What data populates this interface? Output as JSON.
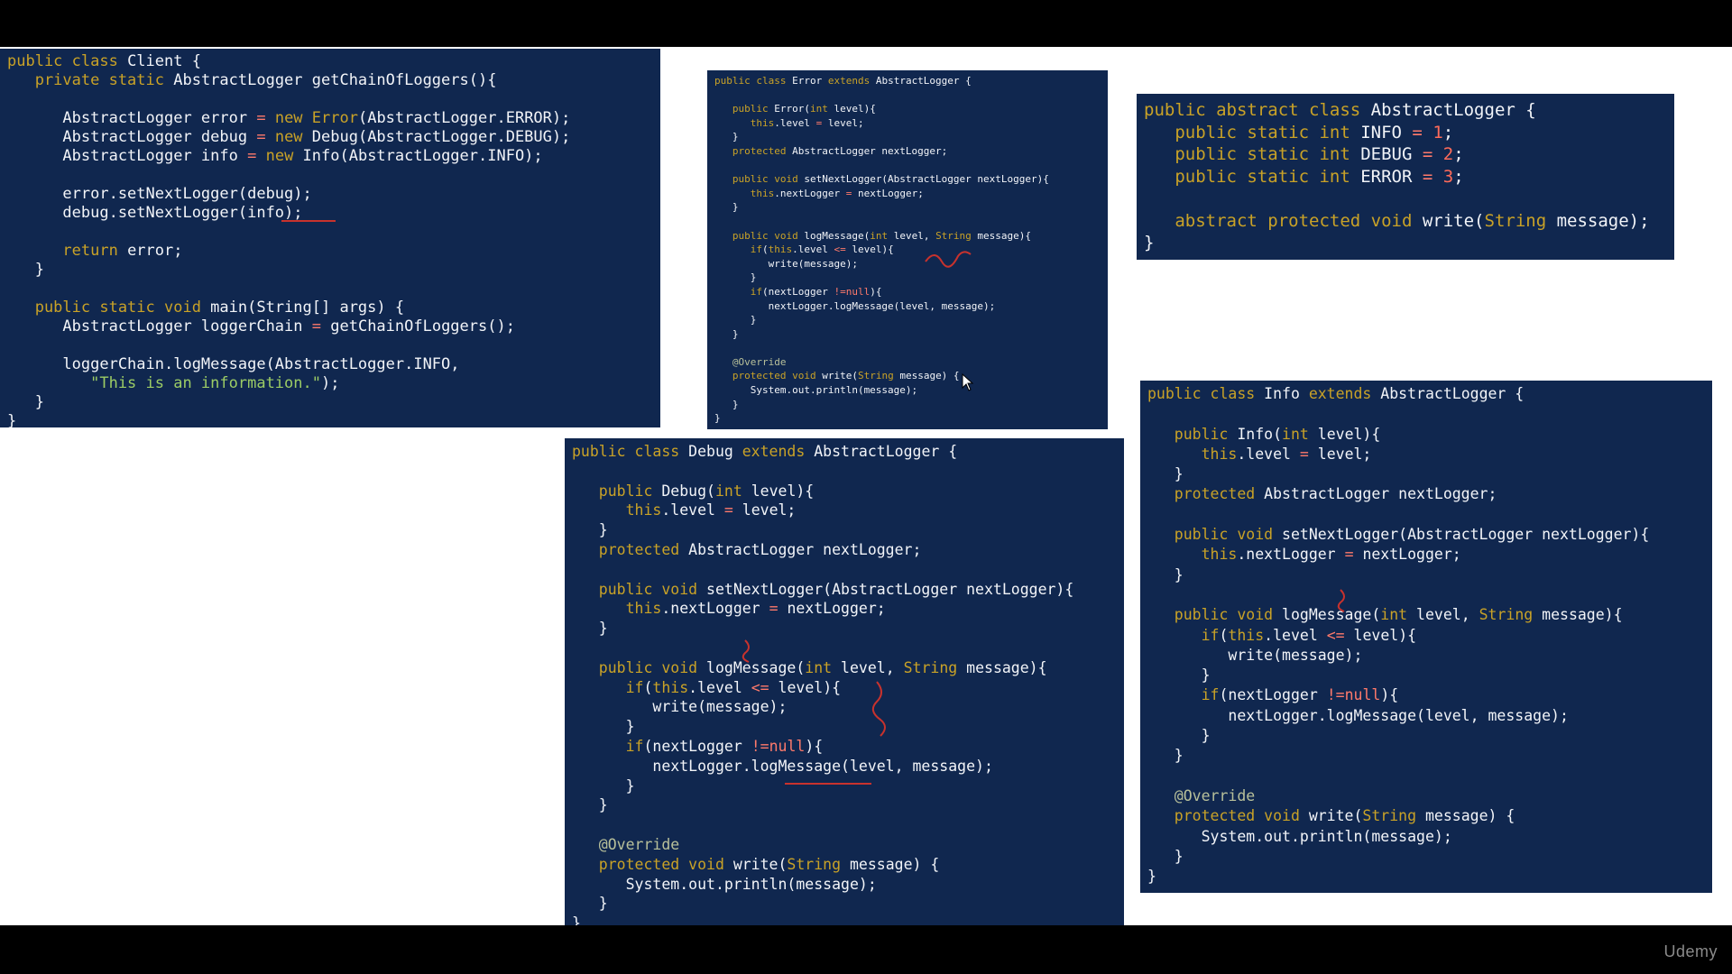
{
  "panels": [
    {
      "id": "client",
      "lines": [
        [
          [
            "kw",
            "public class "
          ],
          [
            "id",
            "Client {"
          ]
        ],
        [
          [
            "kw",
            "   private static "
          ],
          [
            "id",
            "AbstractLogger getChainOfLoggers(){"
          ]
        ],
        [
          [
            "id",
            ""
          ]
        ],
        [
          [
            "id",
            "      AbstractLogger error "
          ],
          [
            "op",
            "= "
          ],
          [
            "kw",
            "new "
          ],
          [
            "kw",
            "Error"
          ],
          [
            "id",
            "(AbstractLogger.ERROR);"
          ]
        ],
        [
          [
            "id",
            "      AbstractLogger debug "
          ],
          [
            "op",
            "= "
          ],
          [
            "kw",
            "new "
          ],
          [
            "id",
            "Debug(AbstractLogger.DEBUG);"
          ]
        ],
        [
          [
            "id",
            "      AbstractLogger info "
          ],
          [
            "op",
            "= "
          ],
          [
            "kw",
            "new "
          ],
          [
            "id",
            "Info(AbstractLogger.INFO);"
          ]
        ],
        [
          [
            "id",
            ""
          ]
        ],
        [
          [
            "id",
            "      error.setNextLogger(debug);"
          ]
        ],
        [
          [
            "id",
            "      debug.setNextLogger(info);"
          ]
        ],
        [
          [
            "id",
            ""
          ]
        ],
        [
          [
            "kw",
            "      return "
          ],
          [
            "id",
            "error;"
          ]
        ],
        [
          [
            "id",
            "   }"
          ]
        ],
        [
          [
            "id",
            ""
          ]
        ],
        [
          [
            "kw",
            "   public static void "
          ],
          [
            "id",
            "main(String[] args) {"
          ]
        ],
        [
          [
            "id",
            "      AbstractLogger loggerChain "
          ],
          [
            "op",
            "= "
          ],
          [
            "id",
            "getChainOfLoggers();"
          ]
        ],
        [
          [
            "id",
            ""
          ]
        ],
        [
          [
            "id",
            "      loggerChain.logMessage(AbstractLogger.INFO,"
          ]
        ],
        [
          [
            "str",
            "         \"This is an information.\""
          ],
          [
            "id",
            ");"
          ]
        ],
        [
          [
            "id",
            "   }"
          ]
        ],
        [
          [
            "id",
            "}"
          ]
        ]
      ]
    },
    {
      "id": "error",
      "lines": [
        [
          [
            "kw",
            "public class "
          ],
          [
            "id",
            "Error "
          ],
          [
            "kw",
            "extends "
          ],
          [
            "id",
            "AbstractLogger {"
          ]
        ],
        [
          [
            "id",
            ""
          ]
        ],
        [
          [
            "kw",
            "   public "
          ],
          [
            "id",
            "Error("
          ],
          [
            "kw",
            "int "
          ],
          [
            "id",
            "level){"
          ]
        ],
        [
          [
            "kw",
            "      this"
          ],
          [
            "id",
            ".level "
          ],
          [
            "op",
            "= "
          ],
          [
            "id",
            "level;"
          ]
        ],
        [
          [
            "id",
            "   }"
          ]
        ],
        [
          [
            "kw",
            "   protected "
          ],
          [
            "id",
            "AbstractLogger nextLogger;"
          ]
        ],
        [
          [
            "id",
            ""
          ]
        ],
        [
          [
            "kw",
            "   public void "
          ],
          [
            "id",
            "setNextLogger(AbstractLogger nextLogger){"
          ]
        ],
        [
          [
            "kw",
            "      this"
          ],
          [
            "id",
            ".nextLogger "
          ],
          [
            "op",
            "= "
          ],
          [
            "id",
            "nextLogger;"
          ]
        ],
        [
          [
            "id",
            "   }"
          ]
        ],
        [
          [
            "id",
            ""
          ]
        ],
        [
          [
            "kw",
            "   public void "
          ],
          [
            "id",
            "logMessage("
          ],
          [
            "kw",
            "int "
          ],
          [
            "id",
            "level, "
          ],
          [
            "kw",
            "String "
          ],
          [
            "id",
            "message){"
          ]
        ],
        [
          [
            "kw",
            "      if"
          ],
          [
            "id",
            "("
          ],
          [
            "kw",
            "this"
          ],
          [
            "id",
            ".level "
          ],
          [
            "op",
            "<= "
          ],
          [
            "id",
            "level){"
          ]
        ],
        [
          [
            "id",
            "         write(message);"
          ]
        ],
        [
          [
            "id",
            "      }"
          ]
        ],
        [
          [
            "kw",
            "      if"
          ],
          [
            "id",
            "(nextLogger "
          ],
          [
            "op",
            "!=null"
          ],
          [
            "id",
            "){"
          ]
        ],
        [
          [
            "id",
            "         nextLogger.logMessage(level, message);"
          ]
        ],
        [
          [
            "id",
            "      }"
          ]
        ],
        [
          [
            "id",
            "   }"
          ]
        ],
        [
          [
            "id",
            ""
          ]
        ],
        [
          [
            "ann",
            "   @Override"
          ]
        ],
        [
          [
            "kw",
            "   protected void "
          ],
          [
            "id",
            "write("
          ],
          [
            "kw",
            "String "
          ],
          [
            "id",
            "message) {"
          ]
        ],
        [
          [
            "id",
            "      System.out.println(message);"
          ]
        ],
        [
          [
            "id",
            "   }"
          ]
        ],
        [
          [
            "id",
            "}"
          ]
        ]
      ]
    },
    {
      "id": "abstract",
      "lines": [
        [
          [
            "kw",
            "public abstract class "
          ],
          [
            "id",
            "AbstractLogger {"
          ]
        ],
        [
          [
            "kw",
            "   public static int "
          ],
          [
            "id",
            "INFO "
          ],
          [
            "op",
            "= "
          ],
          [
            "num",
            "1"
          ],
          [
            "id",
            ";"
          ]
        ],
        [
          [
            "kw",
            "   public static int "
          ],
          [
            "id",
            "DEBUG "
          ],
          [
            "op",
            "= "
          ],
          [
            "num",
            "2"
          ],
          [
            "id",
            ";"
          ]
        ],
        [
          [
            "kw",
            "   public static int "
          ],
          [
            "id",
            "ERROR "
          ],
          [
            "op",
            "= "
          ],
          [
            "num",
            "3"
          ],
          [
            "id",
            ";"
          ]
        ],
        [
          [
            "id",
            ""
          ]
        ],
        [
          [
            "kw",
            "   abstract protected void "
          ],
          [
            "id",
            "write("
          ],
          [
            "kw",
            "String "
          ],
          [
            "id",
            "message);"
          ]
        ],
        [
          [
            "id",
            "}"
          ]
        ]
      ]
    },
    {
      "id": "debug",
      "lines": [
        [
          [
            "kw",
            "public class "
          ],
          [
            "id",
            "Debug "
          ],
          [
            "kw",
            "extends "
          ],
          [
            "id",
            "AbstractLogger {"
          ]
        ],
        [
          [
            "id",
            ""
          ]
        ],
        [
          [
            "kw",
            "   public "
          ],
          [
            "id",
            "Debug("
          ],
          [
            "kw",
            "int "
          ],
          [
            "id",
            "level){"
          ]
        ],
        [
          [
            "kw",
            "      this"
          ],
          [
            "id",
            ".level "
          ],
          [
            "op",
            "= "
          ],
          [
            "id",
            "level;"
          ]
        ],
        [
          [
            "id",
            "   }"
          ]
        ],
        [
          [
            "kw",
            "   protected "
          ],
          [
            "id",
            "AbstractLogger nextLogger;"
          ]
        ],
        [
          [
            "id",
            ""
          ]
        ],
        [
          [
            "kw",
            "   public void "
          ],
          [
            "id",
            "setNextLogger(AbstractLogger nextLogger){"
          ]
        ],
        [
          [
            "kw",
            "      this"
          ],
          [
            "id",
            ".nextLogger "
          ],
          [
            "op",
            "= "
          ],
          [
            "id",
            "nextLogger;"
          ]
        ],
        [
          [
            "id",
            "   }"
          ]
        ],
        [
          [
            "id",
            ""
          ]
        ],
        [
          [
            "kw",
            "   public void "
          ],
          [
            "id",
            "logMessage("
          ],
          [
            "kw",
            "int "
          ],
          [
            "id",
            "level, "
          ],
          [
            "kw",
            "String "
          ],
          [
            "id",
            "message){"
          ]
        ],
        [
          [
            "kw",
            "      if"
          ],
          [
            "id",
            "("
          ],
          [
            "kw",
            "this"
          ],
          [
            "id",
            ".level "
          ],
          [
            "op",
            "<= "
          ],
          [
            "id",
            "level){"
          ]
        ],
        [
          [
            "id",
            "         write(message);"
          ]
        ],
        [
          [
            "id",
            "      }"
          ]
        ],
        [
          [
            "kw",
            "      if"
          ],
          [
            "id",
            "(nextLogger "
          ],
          [
            "op",
            "!=null"
          ],
          [
            "id",
            "){"
          ]
        ],
        [
          [
            "id",
            "         nextLogger.logMessage(level, message);"
          ]
        ],
        [
          [
            "id",
            "      }"
          ]
        ],
        [
          [
            "id",
            "   }"
          ]
        ],
        [
          [
            "id",
            ""
          ]
        ],
        [
          [
            "ann",
            "   @Override"
          ]
        ],
        [
          [
            "kw",
            "   protected void "
          ],
          [
            "id",
            "write("
          ],
          [
            "kw",
            "String "
          ],
          [
            "id",
            "message) {"
          ]
        ],
        [
          [
            "id",
            "      System.out.println(message);"
          ]
        ],
        [
          [
            "id",
            "   }"
          ]
        ],
        [
          [
            "id",
            "}"
          ]
        ]
      ]
    },
    {
      "id": "info",
      "lines": [
        [
          [
            "kw",
            "public class "
          ],
          [
            "id",
            "Info "
          ],
          [
            "kw",
            "extends "
          ],
          [
            "id",
            "AbstractLogger {"
          ]
        ],
        [
          [
            "id",
            ""
          ]
        ],
        [
          [
            "kw",
            "   public "
          ],
          [
            "id",
            "Info("
          ],
          [
            "kw",
            "int "
          ],
          [
            "id",
            "level){"
          ]
        ],
        [
          [
            "kw",
            "      this"
          ],
          [
            "id",
            ".level "
          ],
          [
            "op",
            "= "
          ],
          [
            "id",
            "level;"
          ]
        ],
        [
          [
            "id",
            "   }"
          ]
        ],
        [
          [
            "kw",
            "   protected "
          ],
          [
            "id",
            "AbstractLogger nextLogger;"
          ]
        ],
        [
          [
            "id",
            ""
          ]
        ],
        [
          [
            "kw",
            "   public void "
          ],
          [
            "id",
            "setNextLogger(AbstractLogger nextLogger){"
          ]
        ],
        [
          [
            "kw",
            "      this"
          ],
          [
            "id",
            ".nextLogger "
          ],
          [
            "op",
            "= "
          ],
          [
            "id",
            "nextLogger;"
          ]
        ],
        [
          [
            "id",
            "   }"
          ]
        ],
        [
          [
            "id",
            ""
          ]
        ],
        [
          [
            "kw",
            "   public void "
          ],
          [
            "id",
            "logMessage("
          ],
          [
            "kw",
            "int "
          ],
          [
            "id",
            "level, "
          ],
          [
            "kw",
            "String "
          ],
          [
            "id",
            "message){"
          ]
        ],
        [
          [
            "kw",
            "      if"
          ],
          [
            "id",
            "("
          ],
          [
            "kw",
            "this"
          ],
          [
            "id",
            ".level "
          ],
          [
            "op",
            "<= "
          ],
          [
            "id",
            "level){"
          ]
        ],
        [
          [
            "id",
            "         write(message);"
          ]
        ],
        [
          [
            "id",
            "      }"
          ]
        ],
        [
          [
            "kw",
            "      if"
          ],
          [
            "id",
            "(nextLogger "
          ],
          [
            "op",
            "!=null"
          ],
          [
            "id",
            "){"
          ]
        ],
        [
          [
            "id",
            "         nextLogger.logMessage(level, message);"
          ]
        ],
        [
          [
            "id",
            "      }"
          ]
        ],
        [
          [
            "id",
            "   }"
          ]
        ],
        [
          [
            "id",
            ""
          ]
        ],
        [
          [
            "ann",
            "   @Override"
          ]
        ],
        [
          [
            "kw",
            "   protected void "
          ],
          [
            "id",
            "write("
          ],
          [
            "kw",
            "String "
          ],
          [
            "id",
            "message) {"
          ]
        ],
        [
          [
            "id",
            "      System.out.println(message);"
          ]
        ],
        [
          [
            "id",
            "   }"
          ]
        ],
        [
          [
            "id",
            "}"
          ]
        ]
      ]
    }
  ],
  "watermark": "Udemy",
  "colors": {
    "background": "#ffffff",
    "panel": "#10274f",
    "keyword": "#c9a227",
    "number": "#ff6b5a",
    "string": "#9ccc65",
    "annotation_pen": "#c8322d"
  }
}
